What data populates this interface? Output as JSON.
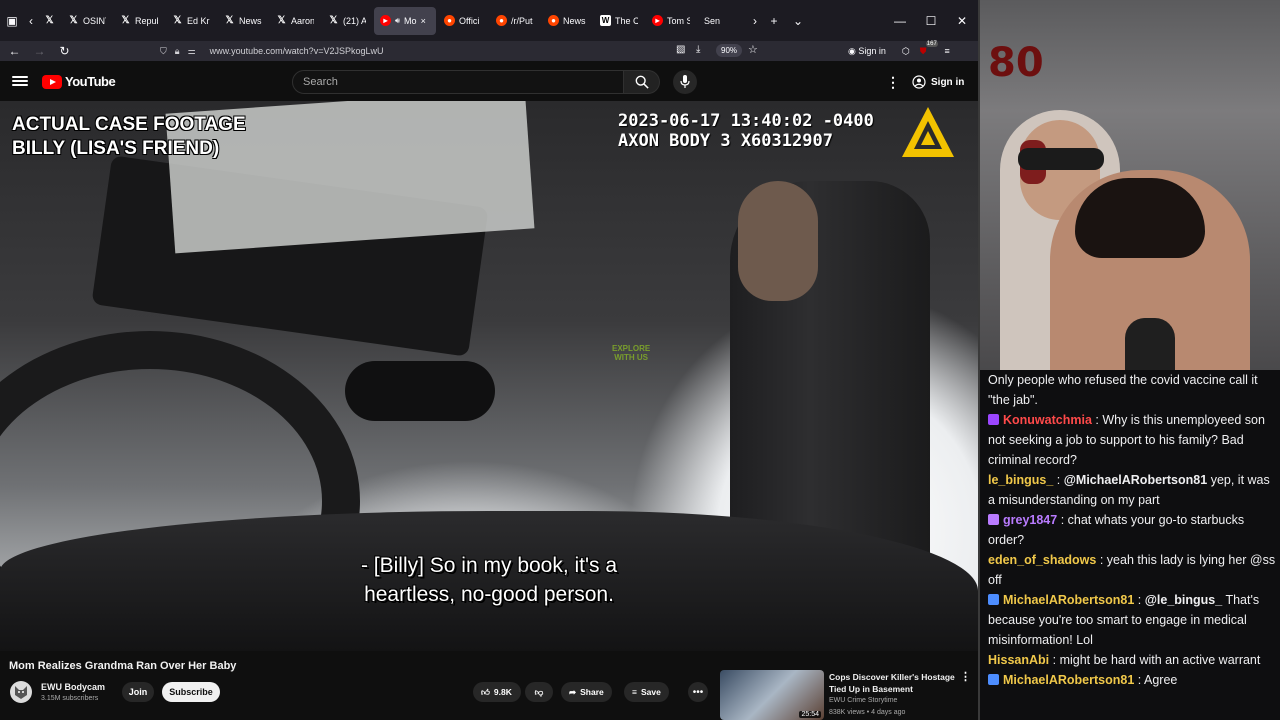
{
  "browser": {
    "tabs": [
      {
        "label": "X",
        "icon": "x-icon",
        "active": false
      },
      {
        "label": "OSINT",
        "icon": "x-icon",
        "active": false
      },
      {
        "label": "Repub",
        "icon": "x-icon",
        "active": false
      },
      {
        "label": "Ed Kr",
        "icon": "x-icon",
        "active": false
      },
      {
        "label": "News",
        "icon": "x-icon",
        "active": false
      },
      {
        "label": "Aaron",
        "icon": "x-icon",
        "active": false
      },
      {
        "label": "(21) A",
        "icon": "x-icon",
        "active": false
      },
      {
        "label": "Mo",
        "icon": "youtube-icon",
        "active": true
      },
      {
        "label": "Offici",
        "icon": "reddit-icon",
        "active": false
      },
      {
        "label": "/r/Put",
        "icon": "reddit-icon",
        "active": false
      },
      {
        "label": "News",
        "icon": "reddit-icon",
        "active": false
      },
      {
        "label": "The C",
        "icon": "wikipedia-icon",
        "active": false
      },
      {
        "label": "Tom S",
        "icon": "youtube-icon",
        "active": false
      },
      {
        "label": "Sen",
        "icon": "none",
        "active": false
      }
    ],
    "url": "www.youtube.com/watch?v=V2JSPkogLwU",
    "zoom": "90%",
    "signin": "Sign in",
    "notification_count": "167"
  },
  "youtube": {
    "logo_text": "YouTube",
    "search_placeholder": "Search",
    "signin": "Sign in"
  },
  "video": {
    "overlay_left_line1": "ACTUAL CASE FOOTAGE",
    "overlay_left_line2": "BILLY (LISA'S FRIEND)",
    "timestamp": "2023-06-17 13:40:02 -0400",
    "device": "AXON BODY 3 X60312907",
    "subtitle_line1": "- [Billy] So in my book, it's a",
    "subtitle_line2": "heartless, no-good person.",
    "watermark_line1": "EXPLORE",
    "watermark_line2": "WITH US"
  },
  "details": {
    "title": "Mom Realizes Grandma Ran Over Her Baby",
    "channel": "EWU Bodycam",
    "subscribers": "3.15M subscribers",
    "join": "Join",
    "subscribe": "Subscribe",
    "likes": "9.8K",
    "share": "Share",
    "save": "Save"
  },
  "recommended": {
    "title": "Cops Discover Killer's Hostage Tied Up in Basement",
    "channel": "EWU Crime Storytime",
    "meta": "838K views • 4 days ago",
    "duration": "25:54"
  },
  "webcam": {
    "backdrop_number": "80"
  },
  "chat": {
    "messages": [
      {
        "user": "",
        "color": "#efeff1",
        "badge": "",
        "mention": "",
        "text": "Only people who refused the covid vaccine call it \"the jab\"."
      },
      {
        "user": "Konuwatchmia",
        "color": "#ff4a4a",
        "badge": "#9b46ff",
        "mention": "",
        "text": "Why is this unemployeed son not seeking a job to support to his family? Bad criminal record?"
      },
      {
        "user": "le_bingus_",
        "color": "#f0c84a",
        "badge": "",
        "mention": "@MichaelARobertson81",
        "text": "yep, it was a misunderstanding on my part"
      },
      {
        "user": "grey1847",
        "color": "#b97bff",
        "badge": "#b97bff",
        "mention": "",
        "text": "chat whats your go-to starbucks order?"
      },
      {
        "user": "eden_of_shadows",
        "color": "#f0c84a",
        "badge": "",
        "mention": "",
        "text": "yeah this lady is lying her @ss off"
      },
      {
        "user": "MichaelARobertson81",
        "color": "#f0c84a",
        "badge": "#4d8dff",
        "mention": "@le_bingus_",
        "text": "That's because you're too smart to engage in medical misinformation! Lol"
      },
      {
        "user": "HissanAbi",
        "color": "#f0c84a",
        "badge": "",
        "mention": "",
        "text": "might be hard with an active warrant"
      },
      {
        "user": "MichaelARobertson81",
        "color": "#f0c84a",
        "badge": "#4d8dff",
        "mention": "",
        "text": "Agree"
      }
    ]
  }
}
